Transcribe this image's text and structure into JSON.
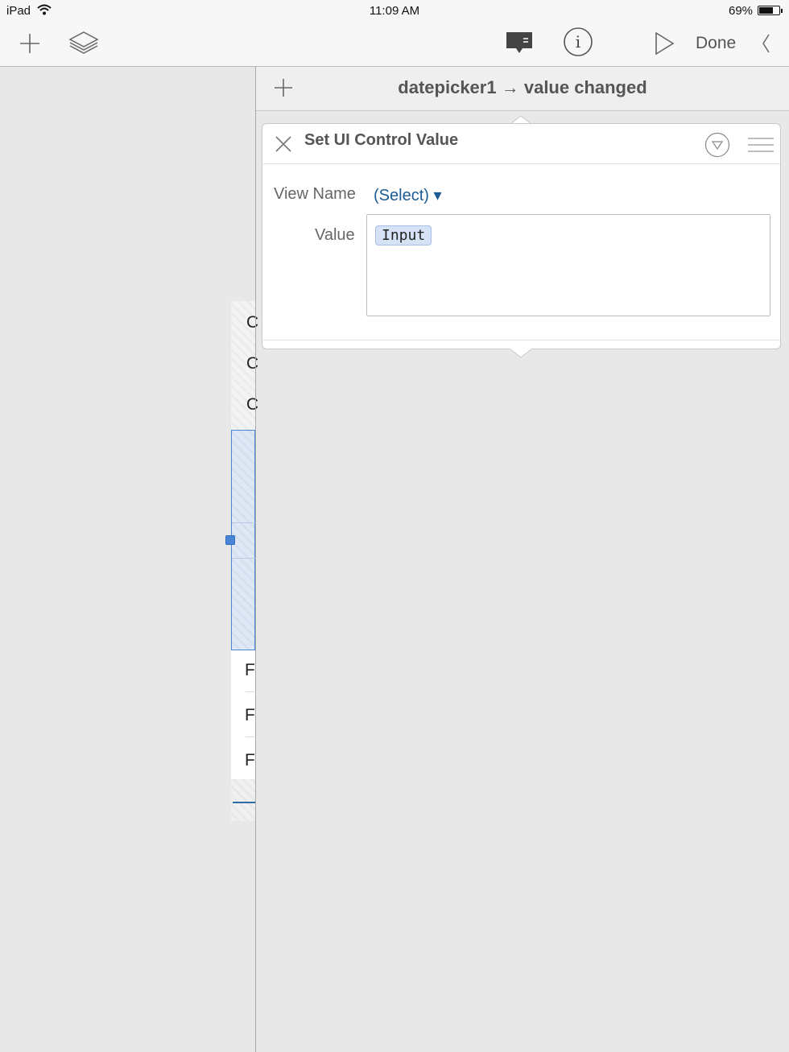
{
  "status_bar": {
    "device": "iPad",
    "time": "11:09 AM",
    "battery_percent": "69%",
    "battery_level": 0.69
  },
  "toolbar": {
    "add_icon": "plus-icon",
    "layers_icon": "layers-icon",
    "comment_icon": "comment-icon",
    "info_icon": "info-icon",
    "play_icon": "play-icon",
    "done_label": "Done",
    "collapse_icon": "chevron-left-icon"
  },
  "canvas": {
    "row_letters": [
      "C",
      "C",
      "C"
    ],
    "list_letters": [
      "F",
      "F",
      "F"
    ]
  },
  "panel": {
    "add_icon": "plus-icon",
    "event_source": "datepicker1",
    "arrow": "→",
    "event_name": "value changed"
  },
  "action_card": {
    "title": "Set UI Control Value",
    "close_icon": "close-icon",
    "dropdown_icon": "triangle-down-icon",
    "drag_icon": "hamburger-icon",
    "view_name_label": "View Name",
    "view_name_value": "(Select) ▾",
    "value_label": "Value",
    "value_token": "Input"
  },
  "colors": {
    "link": "#1b5c94",
    "selection": "#4a86d6",
    "token_bg": "#d6e3f6"
  }
}
